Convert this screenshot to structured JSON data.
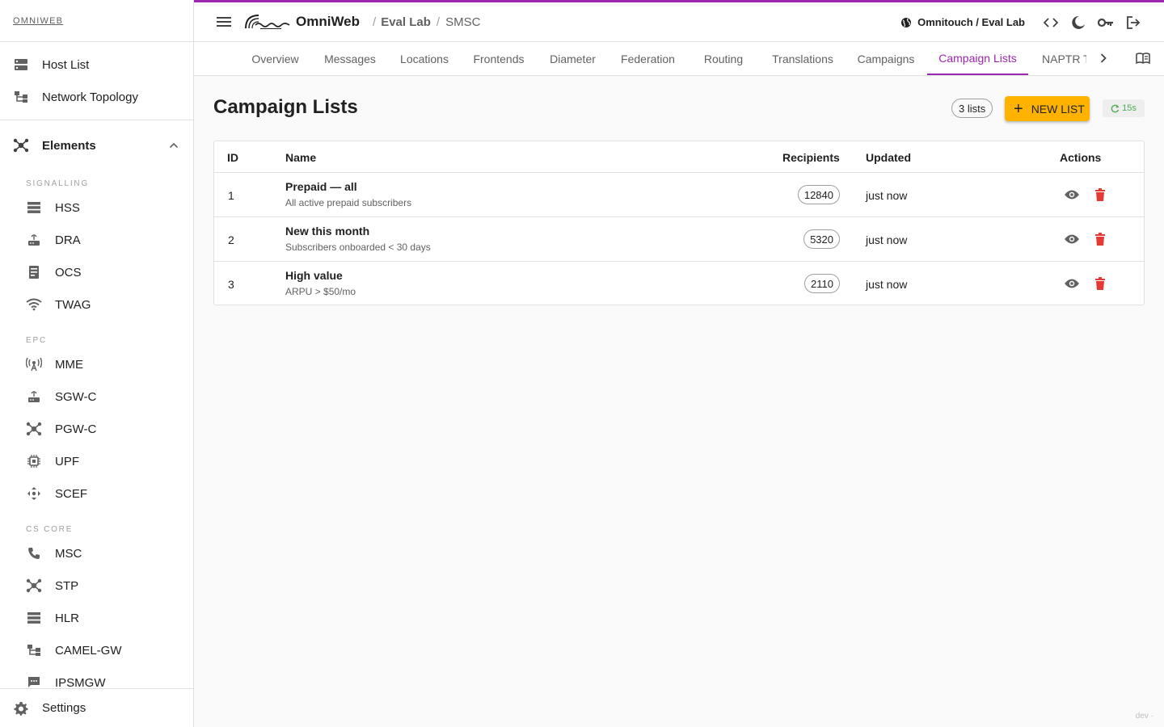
{
  "brand": "OMNIWEB",
  "sidebar": {
    "top_items": [
      {
        "label": "Host List",
        "icon": "host-list-icon"
      },
      {
        "label": "Network Topology",
        "icon": "topology-icon"
      }
    ],
    "group": {
      "label": "Elements",
      "expanded": true
    },
    "sections": [
      {
        "label": "SIGNALLING",
        "items": [
          {
            "label": "HSS",
            "icon": "storage-icon"
          },
          {
            "label": "DRA",
            "icon": "router-icon"
          },
          {
            "label": "OCS",
            "icon": "billing-icon"
          },
          {
            "label": "TWAG",
            "icon": "wifi-icon"
          }
        ]
      },
      {
        "label": "EPC",
        "items": [
          {
            "label": "MME",
            "icon": "antenna-icon"
          },
          {
            "label": "SGW-C",
            "icon": "router-icon"
          },
          {
            "label": "PGW-C",
            "icon": "hub-icon"
          },
          {
            "label": "UPF",
            "icon": "chip-icon"
          },
          {
            "label": "SCEF",
            "icon": "arrows-icon"
          }
        ]
      },
      {
        "label": "CS CORE",
        "items": [
          {
            "label": "MSC",
            "icon": "phone-icon"
          },
          {
            "label": "STP",
            "icon": "hub-icon"
          },
          {
            "label": "HLR",
            "icon": "storage-icon"
          },
          {
            "label": "CAMEL-GW",
            "icon": "topology-icon"
          },
          {
            "label": "IPSMGW",
            "icon": "message-icon"
          }
        ]
      }
    ],
    "settings_label": "Settings"
  },
  "topbar": {
    "app_name": "OmniWeb",
    "breadcrumb": [
      "Eval Lab",
      "SMSC"
    ],
    "tenant": "Omnitouch / Eval Lab"
  },
  "tabs": [
    {
      "label": "Overview",
      "active": false
    },
    {
      "label": "Messages",
      "active": false
    },
    {
      "label": "Locations",
      "active": false
    },
    {
      "label": "Frontends",
      "active": false
    },
    {
      "label": "Diameter",
      "active": false
    },
    {
      "label": "Federation",
      "active": false
    },
    {
      "label": "Routing",
      "active": false
    },
    {
      "label": "Translations",
      "active": false
    },
    {
      "label": "Campaigns",
      "active": false
    },
    {
      "label": "Campaign Lists",
      "active": true
    },
    {
      "label": "NAPTR T",
      "active": false
    }
  ],
  "main": {
    "title": "Campaign Lists",
    "count_label": "3 lists",
    "new_button_label": "NEW LIST",
    "refresh_label": "15s",
    "table": {
      "headers": {
        "id": "ID",
        "name": "Name",
        "recipients": "Recipients",
        "updated": "Updated",
        "actions": "Actions"
      },
      "rows": [
        {
          "id": "1",
          "name": "Prepaid — all",
          "description": "All active prepaid subscribers",
          "recipients": "12840",
          "updated": "just now"
        },
        {
          "id": "2",
          "name": "New this month",
          "description": "Subscribers onboarded < 30 days",
          "recipients": "5320",
          "updated": "just now"
        },
        {
          "id": "3",
          "name": "High value",
          "description": "ARPU > $50/mo",
          "recipients": "2110",
          "updated": "just now"
        }
      ]
    }
  },
  "footer": {
    "dev_tag": "dev ·"
  },
  "colors": {
    "accent": "#9c27b0",
    "primary_button": "#ffb300",
    "delete": "#e53935",
    "refresh": "#4caf50"
  }
}
